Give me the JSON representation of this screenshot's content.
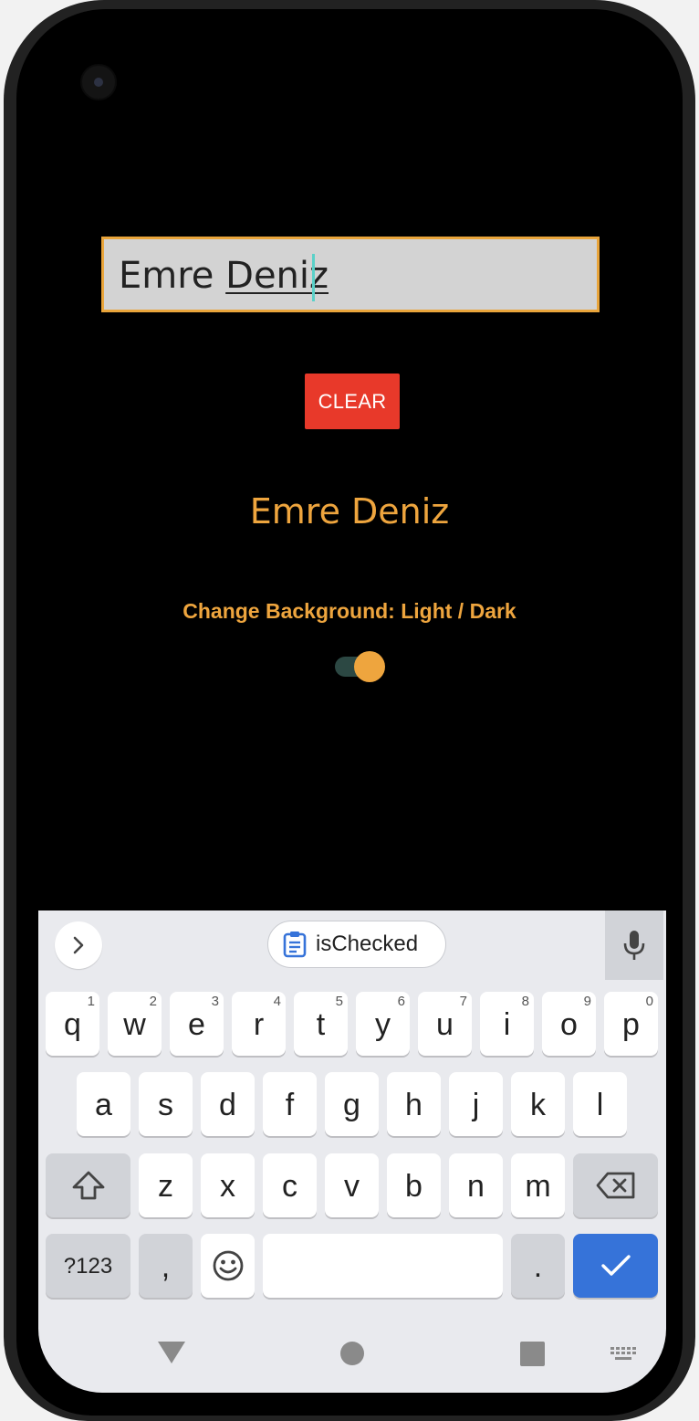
{
  "text_input": {
    "value_plain": "Emre ",
    "value_underlined": "Deniz"
  },
  "clear_button": {
    "label": "CLEAR"
  },
  "echo_text": "Emre Deniz",
  "background_toggle": {
    "label": "Change Background: Light / Dark",
    "on": true
  },
  "keyboard": {
    "suggestion": "isChecked",
    "rows": [
      [
        {
          "label": "q",
          "hint": "1"
        },
        {
          "label": "w",
          "hint": "2"
        },
        {
          "label": "e",
          "hint": "3"
        },
        {
          "label": "r",
          "hint": "4"
        },
        {
          "label": "t",
          "hint": "5"
        },
        {
          "label": "y",
          "hint": "6"
        },
        {
          "label": "u",
          "hint": "7"
        },
        {
          "label": "i",
          "hint": "8"
        },
        {
          "label": "o",
          "hint": "9"
        },
        {
          "label": "p",
          "hint": "0"
        }
      ],
      [
        {
          "label": "a"
        },
        {
          "label": "s"
        },
        {
          "label": "d"
        },
        {
          "label": "f"
        },
        {
          "label": "g"
        },
        {
          "label": "h"
        },
        {
          "label": "j"
        },
        {
          "label": "k"
        },
        {
          "label": "l"
        }
      ],
      [
        {
          "label": "z"
        },
        {
          "label": "x"
        },
        {
          "label": "c"
        },
        {
          "label": "v"
        },
        {
          "label": "b"
        },
        {
          "label": "n"
        },
        {
          "label": "m"
        }
      ]
    ],
    "symbols_key": "?123",
    "comma_key": ",",
    "period_key": ".",
    "icons": [
      "chevron-right-icon",
      "clipboard-icon",
      "microphone-icon",
      "shift-icon",
      "backspace-icon",
      "emoji-icon",
      "check-icon"
    ]
  },
  "navigation_bar": {
    "icons": [
      "back-icon",
      "home-icon",
      "recents-icon",
      "keyboard-switch-icon"
    ]
  },
  "colors": {
    "screen_background": "#000000",
    "accent": "#EEA53E",
    "clear_button": "#E8392A",
    "keyboard_action": "#3673D9"
  }
}
